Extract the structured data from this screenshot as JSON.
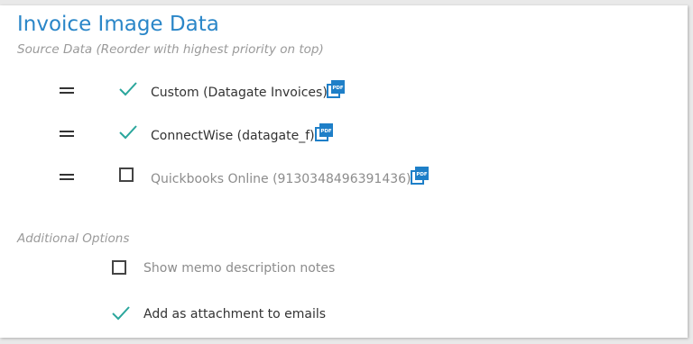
{
  "panel": {
    "title": "Invoice Image Data",
    "subtitle": "Source Data (Reorder with highest priority on top)"
  },
  "sources": [
    {
      "label": "Custom (Datagate Invoices)",
      "checked": true,
      "pdf_icon_text": "PDF"
    },
    {
      "label": "ConnectWise (datagate_f)",
      "checked": true,
      "pdf_icon_text": "PDF"
    },
    {
      "label": "Quickbooks Online (9130348496391436)",
      "checked": false,
      "pdf_icon_text": "PDF"
    }
  ],
  "additional": {
    "label": "Additional Options",
    "options": [
      {
        "label": "Show memo description notes",
        "checked": false
      },
      {
        "label": "Add as attachment to emails",
        "checked": true
      }
    ]
  },
  "colors": {
    "title": "#2a86c8",
    "check": "#2aa69c",
    "pdf_icon": "#1e7fc8"
  },
  "icons": {
    "drag": "drag-handle-icon",
    "check": "checkmark-icon",
    "pdf": "pdf-icon"
  }
}
